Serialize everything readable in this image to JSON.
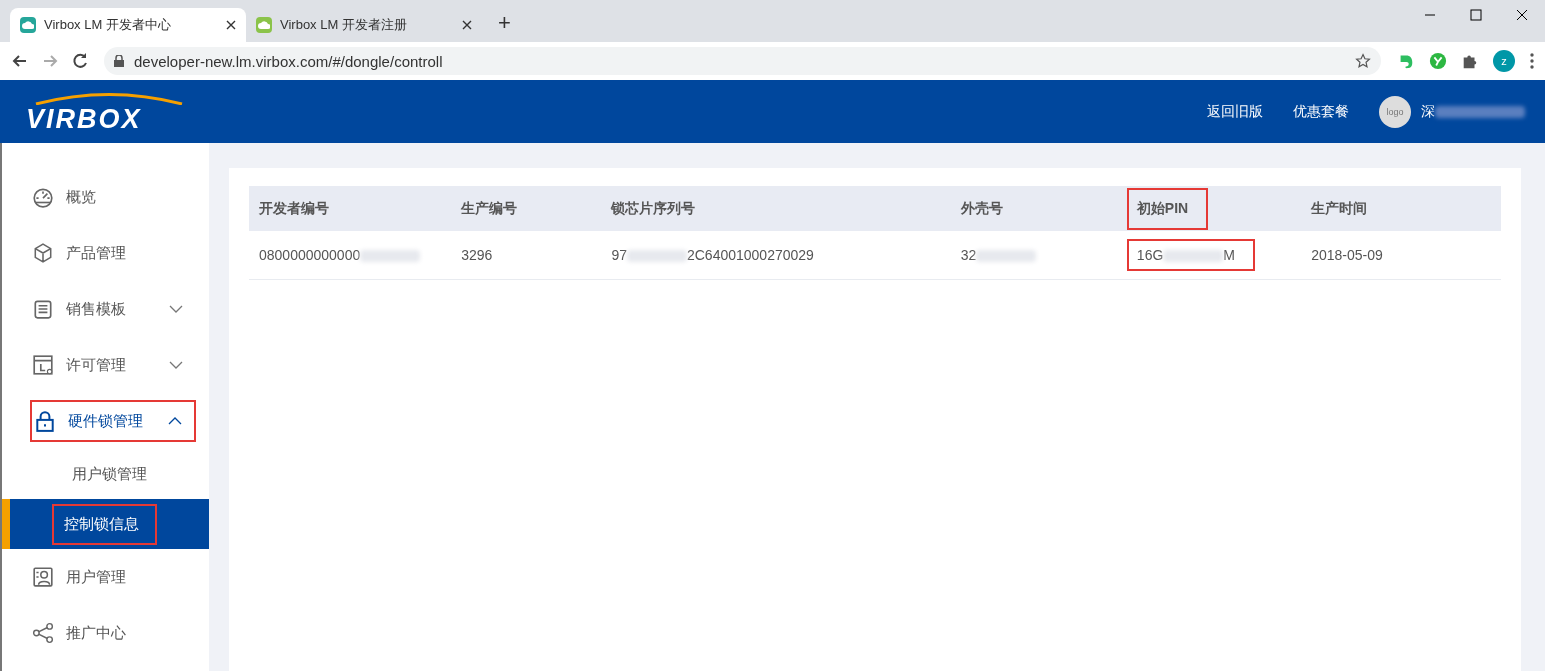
{
  "browser": {
    "tabs": [
      {
        "title": "Virbox LM 开发者中心",
        "selected": true,
        "color": "#26a69a"
      },
      {
        "title": "Virbox LM 开发者注册",
        "selected": false,
        "color": "#8bc34a"
      }
    ],
    "new_tab": "+",
    "url": "developer-new.lm.virbox.com/#/dongle/controll",
    "profile": "z"
  },
  "header": {
    "logo": "VIRBOX",
    "links": [
      "返回旧版",
      "优惠套餐"
    ],
    "avatar": "logo",
    "user": {
      "parts": [
        "深"
      ],
      "masked": true
    }
  },
  "sidebar": {
    "items": [
      {
        "label": "概览",
        "kind": "link",
        "highlighted": false
      },
      {
        "label": "产品管理",
        "kind": "link",
        "highlighted": false
      },
      {
        "label": "销售模板",
        "kind": "group",
        "expanded": false,
        "highlighted": false
      },
      {
        "label": "许可管理",
        "kind": "group",
        "expanded": false,
        "highlighted": false
      },
      {
        "label": "硬件锁管理",
        "kind": "group",
        "expanded": true,
        "highlighted": true,
        "children": [
          {
            "label": "用户锁管理",
            "selected": false,
            "highlighted": false
          },
          {
            "label": "控制锁信息",
            "selected": true,
            "highlighted": true
          }
        ]
      },
      {
        "label": "用户管理",
        "kind": "link",
        "highlighted": false
      },
      {
        "label": "推广中心",
        "kind": "link",
        "highlighted": false
      }
    ]
  },
  "table": {
    "columns": [
      {
        "label": "开发者编号",
        "highlighted": false
      },
      {
        "label": "生产编号",
        "highlighted": false
      },
      {
        "label": "锁芯片序列号",
        "highlighted": false
      },
      {
        "label": "外壳号",
        "highlighted": false
      },
      {
        "label": "初始PIN",
        "highlighted": true
      },
      {
        "label": "生产时间",
        "highlighted": false
      }
    ],
    "rows": [
      [
        {
          "parts": [
            "0800000000000"
          ],
          "masked": true
        },
        {
          "parts": [
            "3296"
          ],
          "masked": false
        },
        {
          "parts": [
            "97",
            "2C64001000270029"
          ],
          "masked": true
        },
        {
          "parts": [
            "32"
          ],
          "masked": true
        },
        {
          "parts": [
            "16G",
            "M"
          ],
          "masked": true
        },
        {
          "parts": [
            "2018-05-09"
          ],
          "masked": false
        }
      ]
    ]
  }
}
